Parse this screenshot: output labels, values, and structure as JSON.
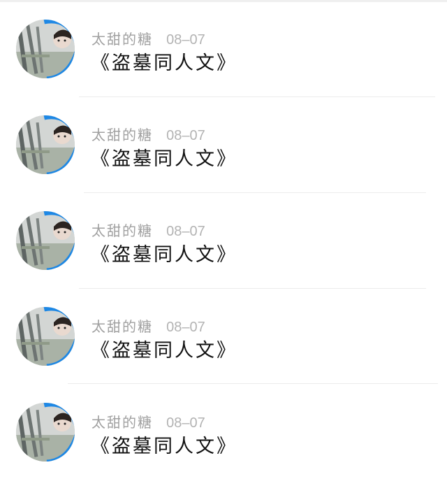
{
  "feed": {
    "items": [
      {
        "username": "太甜的糖",
        "date": "08–07",
        "text": "《盗墓同人文》"
      },
      {
        "username": "太甜的糖",
        "date": "08–07",
        "text": "《盗墓同人文》"
      },
      {
        "username": "太甜的糖",
        "date": "08–07",
        "text": "《盗墓同人文》"
      },
      {
        "username": "太甜的糖",
        "date": "08–07",
        "text": "《盗墓同人文》"
      },
      {
        "username": "太甜的糖",
        "date": "08–07",
        "text": "《盗墓同人文》"
      }
    ]
  },
  "colors": {
    "username": "#a0a0a0",
    "date": "#b3b3b3",
    "content": "#111111",
    "divider": "#ececec",
    "avatar_accent": "#1e88e5"
  },
  "icons": {
    "avatar": "user-avatar-photo"
  }
}
